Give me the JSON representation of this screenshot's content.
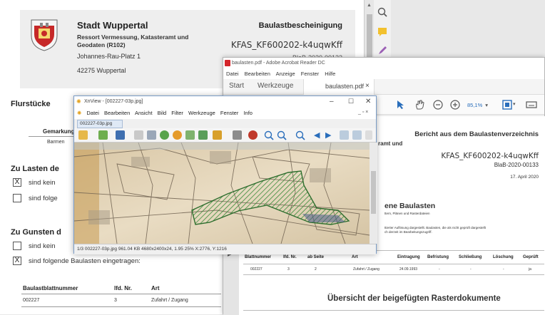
{
  "bgdoc": {
    "city": "Stadt Wuppertal",
    "department": "Ressort Vermessung, Katasteramt und Geodaten (R102)",
    "street": "Johannes-Rau-Platz 1",
    "zip_city": "42275 Wuppertal",
    "doc_title": "Baulastbescheinigung",
    "doc_id": "KFAS_KF600202-k4uqwKff",
    "doc_ref": "BlaB-2020-00133",
    "sections": {
      "flurstuecke": "Flurstücke",
      "gemarkung_col": "Gemarkung",
      "gemarkung_val": "Barmen",
      "zu_lasten": "Zu Lasten de",
      "lasten_opt1": "sind kein",
      "lasten_opt2": "sind folge",
      "zu_gunsten": "Zu Gunsten d",
      "gunsten_opt1": "sind kein",
      "gunsten_opt2": "sind folgende Baulasten eingetragen:",
      "gunsten_opt2_checked": "X",
      "lasten_opt1_checked": "X"
    },
    "table": {
      "headers": [
        "Baulastblattnummer",
        "lfd. Nr.",
        "Art"
      ],
      "row": [
        "002227",
        "3",
        "Zufahrt / Zugang"
      ]
    }
  },
  "acrobat": {
    "title": "baulasten.pdf - Adobe Acrobat Reader DC",
    "menu": [
      "Datei",
      "Bearbeiten",
      "Anzeige",
      "Fenster",
      "Hilfe"
    ],
    "tabs": {
      "start": "Start",
      "werkzeuge": "Werkzeuge",
      "file": "baulasten.pdf",
      "close": "×"
    },
    "zoom": "85,1%",
    "page": {
      "report_title": "Bericht aus dem Baulastenverzeichnis",
      "dept_tail": "ramt und",
      "doc_id": "KFAS_KF600202-k4uqwKff",
      "doc_ref": "BlaB-2020-00133",
      "date": "17. April 2020",
      "section_head": "ene Baulasten",
      "section_sub": "ttern, Plänen und Rasterdateien",
      "note1": "ttierter Auflösung dargestellt. Baulasten, die als nicht geprüft dargestellt",
      "note2": "ch derzeit im Bearbeitungszugriff.",
      "headers": [
        "Blattnummer",
        "lfd. Nr.",
        "ab Seite",
        "Art",
        "Eintragung",
        "Befristung",
        "Schließung",
        "Löschung",
        "Geprüft"
      ],
      "row": [
        "002227",
        "3",
        "2",
        "Zufahrt / Zugang",
        "24.09.1993",
        "-",
        "-",
        "-",
        "ja"
      ],
      "overview": "Übersicht der beigefügten Rasterdokumente"
    }
  },
  "xnview": {
    "title": "XnView - [002227-03p.jpg]",
    "menu": [
      "Datei",
      "Bearbeiten",
      "Ansicht",
      "Bild",
      "Filter",
      "Werkzeuge",
      "Fenster",
      "Info"
    ],
    "tab": "002227-03p.jpg",
    "status": "1/3   002227-03p.jpg   961.04 KB   4680x2400x24, 1.95   25%   X:2776, Y:1216"
  },
  "colors": {
    "hatch": "#3a8a3a",
    "acrobat_red": "#d4262b",
    "accent_blue": "#2a6ebb"
  }
}
